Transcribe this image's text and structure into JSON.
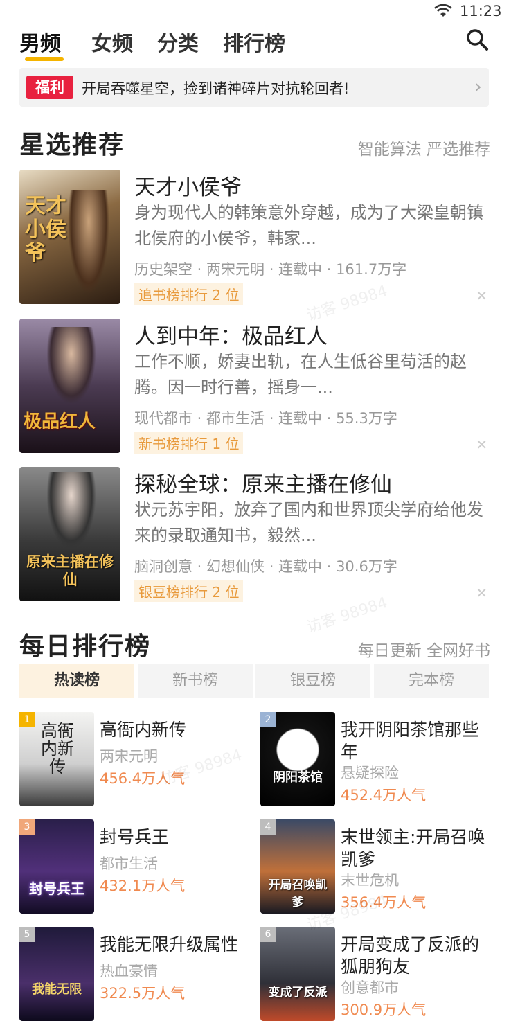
{
  "status": {
    "time": "11:23"
  },
  "nav": {
    "tabs": [
      "男频",
      "女频",
      "分类",
      "排行榜"
    ]
  },
  "banner": {
    "badge": "福利",
    "text": "开局吞噬星空，捡到诸神碎片对抗轮回者!"
  },
  "featured": {
    "title": "星选推荐",
    "subtitle": "智能算法 严选推荐",
    "books": [
      {
        "title": "天才小侯爷",
        "desc": "身为现代人的韩策意外穿越，成为了大梁皇朝镇北侯府的小侯爷，韩家...",
        "meta": "历史架空 · 两宋元明 · 连载中 · 161.7万字",
        "rank": "追书榜排行 2 位",
        "cover_text": "天才小侯爷"
      },
      {
        "title": "人到中年：极品红人",
        "desc": "工作不顺，娇妻出轨，在人生低谷里苟活的赵腾。因一时行善，摇身一...",
        "meta": "现代都市 · 都市生活 · 连载中 · 55.3万字",
        "rank": "新书榜排行 1 位",
        "cover_text": "极品红人"
      },
      {
        "title": "探秘全球：原来主播在修仙",
        "desc": "状元苏宇阳，放弃了国内和世界顶尖学府给他发来的录取通知书，毅然...",
        "meta": "脑洞创意 · 幻想仙侠 · 连载中 · 30.6万字",
        "rank": "银豆榜排行 2 位",
        "cover_text": "原来主播在修仙"
      }
    ]
  },
  "ranking": {
    "title": "每日排行榜",
    "subtitle": "每日更新 全网好书",
    "tabs": [
      "热读榜",
      "新书榜",
      "银豆榜",
      "完本榜"
    ],
    "items": [
      {
        "num": "1",
        "title": "高衙内新传",
        "genre": "两宋元明",
        "popularity": "456.4万人气",
        "cover_text": "高衙内新传"
      },
      {
        "num": "2",
        "title": "我开阴阳茶馆那些年",
        "genre": "悬疑探险",
        "popularity": "452.4万人气",
        "cover_text": "阴阳茶馆"
      },
      {
        "num": "3",
        "title": "封号兵王",
        "genre": "都市生活",
        "popularity": "432.1万人气",
        "cover_text": "封号兵王"
      },
      {
        "num": "4",
        "title": "末世领主:开局召唤凯爹",
        "genre": "末世危机",
        "popularity": "356.4万人气",
        "cover_text": "开局召唤凯爹"
      },
      {
        "num": "5",
        "title": "我能无限升级属性",
        "genre": "热血豪情",
        "popularity": "322.5万人气",
        "cover_text": "我能无限"
      },
      {
        "num": "6",
        "title": "开局变成了反派的狐朋狗友",
        "genre": "创意都市",
        "popularity": "300.9万人气",
        "cover_text": "变成了反派"
      }
    ]
  },
  "watermark": "访客 98984",
  "colors": {
    "accent": "#f5b400",
    "badge": "#e8213f",
    "rank_text": "#e89a3c",
    "popularity": "#f08a50"
  }
}
